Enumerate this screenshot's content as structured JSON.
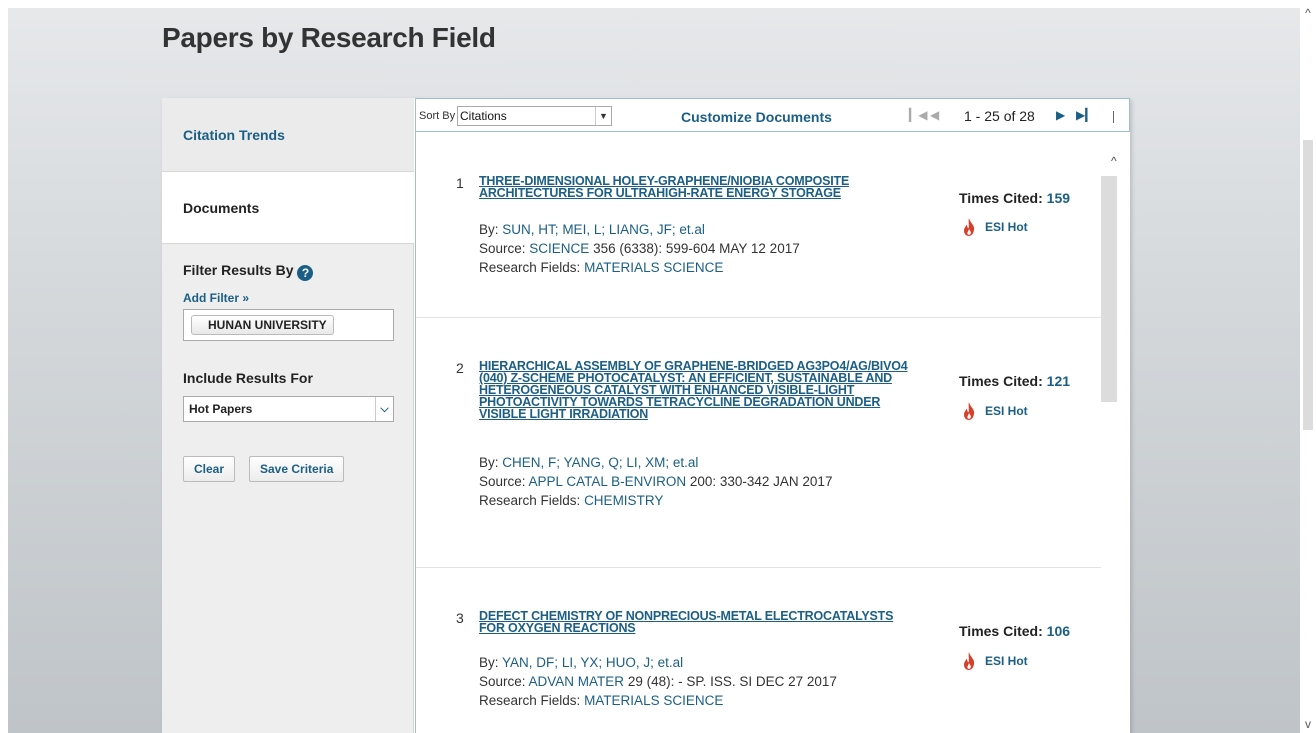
{
  "page": {
    "title": "Papers by Research Field"
  },
  "sidebar": {
    "tabs": [
      {
        "label": "Citation Trends"
      },
      {
        "label": "Documents"
      }
    ],
    "filter_label": "Filter Results By",
    "help_glyph": "?",
    "add_filter": "Add Filter »",
    "active_filter": "HUNAN UNIVERSITY",
    "include_label": "Include Results For",
    "include_value": "Hot Papers",
    "clear_label": "Clear",
    "save_label": "Save Criteria"
  },
  "toolbar": {
    "sort_label": "Sort By",
    "sort_value": "Citations",
    "customize": "Customize Documents",
    "range": "1 - 25 of 28"
  },
  "documents": [
    {
      "num": "1",
      "title": "THREE-DIMENSIONAL HOLEY-GRAPHENE/NIOBIA COMPOSITE ARCHITECTURES FOR ULTRAHIGH-RATE ENERGY STORAGE",
      "by_label": "By:",
      "authors": [
        "SUN, HT;",
        "MEI, L;",
        "LIANG, JF;",
        "et.al"
      ],
      "source_label": "Source:",
      "journal": "SCIENCE",
      "source_rest": " 356 (6338): 599-604 MAY 12 2017",
      "fields_label": "Research Fields:",
      "field": "MATERIALS SCIENCE",
      "cited_label": "Times Cited:",
      "cited": "159",
      "esi": "ESI Hot"
    },
    {
      "num": "2",
      "title": "HIERARCHICAL ASSEMBLY OF GRAPHENE-BRIDGED AG3PO4/AG/BIVO4 (040) Z-SCHEME PHOTOCATALYST: AN EFFICIENT, SUSTAINABLE AND HETEROGENEOUS CATALYST WITH ENHANCED VISIBLE-LIGHT PHOTOACTIVITY TOWARDS TETRACYCLINE DEGRADATION UNDER VISIBLE LIGHT IRRADIATION",
      "by_label": "By:",
      "authors": [
        "CHEN, F;",
        "YANG, Q;",
        "LI, XM;",
        "et.al"
      ],
      "source_label": "Source:",
      "journal": "APPL CATAL B-ENVIRON",
      "source_rest": " 200: 330-342 JAN 2017",
      "fields_label": "Research Fields:",
      "field": "CHEMISTRY",
      "cited_label": "Times Cited:",
      "cited": "121",
      "esi": "ESI Hot"
    },
    {
      "num": "3",
      "title": "DEFECT CHEMISTRY OF NONPRECIOUS-METAL ELECTROCATALYSTS FOR OXYGEN REACTIONS",
      "by_label": "By:",
      "authors": [
        "YAN, DF;",
        "LI, YX;",
        "HUO, J;",
        "et.al"
      ],
      "source_label": "Source:",
      "journal": "ADVAN MATER",
      "source_rest": " 29 (48): - SP. ISS. SI DEC 27 2017",
      "fields_label": "Research Fields:",
      "field": "MATERIALS SCIENCE",
      "cited_label": "Times Cited:",
      "cited": "106",
      "esi": "ESI Hot"
    }
  ],
  "icons": {
    "flame": "flame-icon",
    "help": "help-icon",
    "first": "first-page-icon",
    "prev": "prev-page-icon",
    "next": "next-page-icon",
    "last": "last-page-icon"
  },
  "colors": {
    "link": "#1b5f86",
    "flame": "#d6402a"
  }
}
